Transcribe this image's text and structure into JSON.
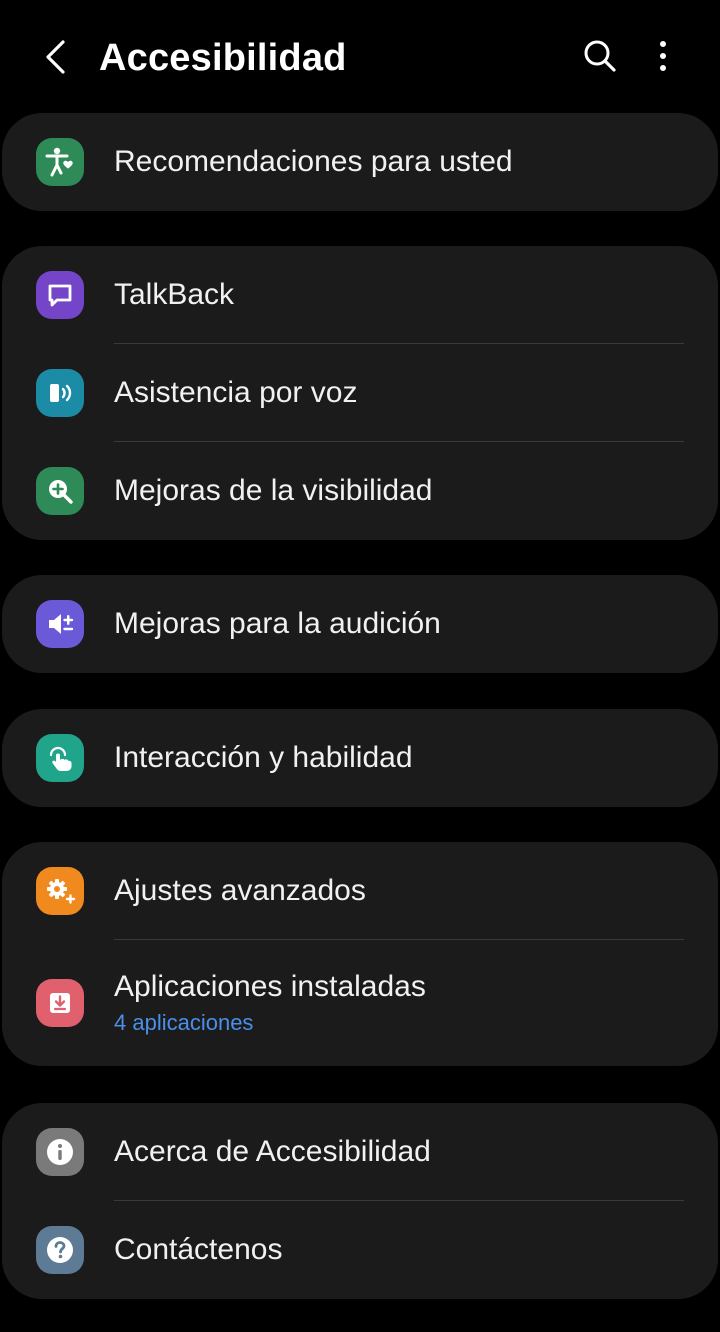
{
  "header": {
    "title": "Accesibilidad",
    "back_icon": "chevron-left-icon",
    "search_icon": "search-icon",
    "more_icon": "more-vertical-icon"
  },
  "colors": {
    "background": "#000000",
    "card": "#1b1b1b",
    "text": "#f1f1f1",
    "link": "#4a8fe8",
    "divider": "#3a3a3a"
  },
  "groups": [
    {
      "items": [
        {
          "label": "Recomendaciones para usted",
          "icon": "accessibility-heart-icon",
          "icon_color": "#2e8b57"
        }
      ]
    },
    {
      "items": [
        {
          "label": "TalkBack",
          "icon": "talkback-chat-icon",
          "icon_color": "#7445c8"
        },
        {
          "label": "Asistencia por voz",
          "icon": "voice-assistance-icon",
          "icon_color": "#1c8ca6"
        },
        {
          "label": "Mejoras de la visibilidad",
          "icon": "zoom-in-icon",
          "icon_color": "#2e8b57"
        }
      ]
    },
    {
      "items": [
        {
          "label": "Mejoras para la audición",
          "icon": "volume-adjust-icon",
          "icon_color": "#6a5ad8"
        }
      ]
    },
    {
      "items": [
        {
          "label": "Interacción y habilidad",
          "icon": "touch-hand-icon",
          "icon_color": "#21a58a"
        }
      ]
    },
    {
      "items": [
        {
          "label": "Ajustes avanzados",
          "icon": "gear-plus-icon",
          "icon_color": "#f0891e"
        },
        {
          "label": "Aplicaciones instaladas",
          "sublabel": "4 aplicaciones",
          "icon": "download-box-icon",
          "icon_color": "#e0606e"
        }
      ]
    },
    {
      "items": [
        {
          "label": "Acerca de Accesibilidad",
          "icon": "info-icon",
          "icon_color": "#7a7a7a"
        },
        {
          "label": "Contáctenos",
          "icon": "help-question-icon",
          "icon_color": "#5e7b95"
        }
      ]
    }
  ]
}
